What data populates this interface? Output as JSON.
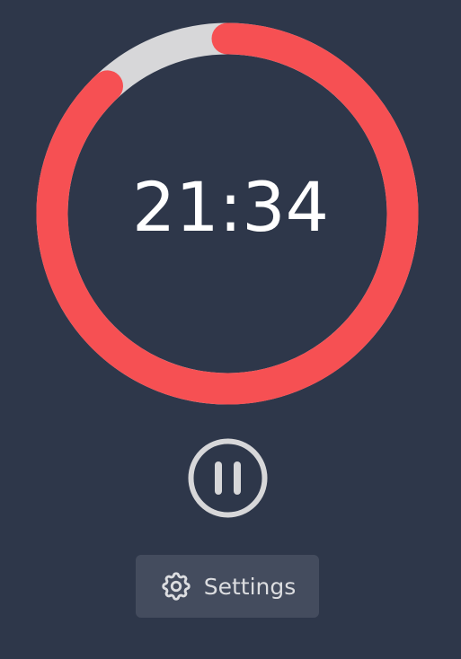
{
  "timer": {
    "time": "21:34",
    "progress_remaining": 0.88
  },
  "controls": {
    "pause_icon": "pause-circle-icon",
    "settings_icon": "gear-icon",
    "settings_label": "Settings"
  },
  "colors": {
    "background": "#2e374a",
    "ring_progress": "#f65053",
    "ring_track": "#d7d7d9",
    "text": "#ffffff",
    "control": "#d7d7d9",
    "button_bg": "#444c5e"
  }
}
